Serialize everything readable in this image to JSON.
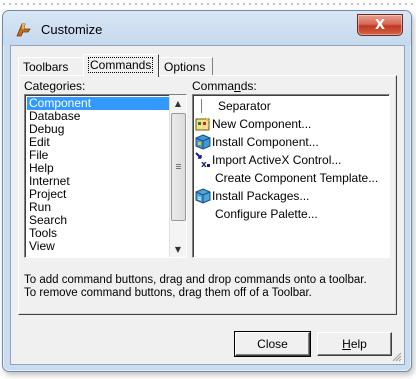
{
  "window": {
    "title": "Customize",
    "close_glyph": "X",
    "app_icon": "delphi-helmet-icon"
  },
  "tabs": [
    {
      "label": "Toolbars",
      "active": false
    },
    {
      "label": "Commands",
      "active": true
    },
    {
      "label": "Options",
      "active": false
    }
  ],
  "categories": {
    "label": "Categories:",
    "items": [
      "Component",
      "Database",
      "Debug",
      "Edit",
      "File",
      "Help",
      "Internet",
      "Project",
      "Run",
      "Search",
      "Tools",
      "View"
    ],
    "selected": "Component"
  },
  "commands": {
    "label": "Commands:",
    "items": [
      {
        "label": "Separator",
        "icon": "separator-icon"
      },
      {
        "label": "New Component...",
        "icon": "new-component-icon"
      },
      {
        "label": "Install Component...",
        "icon": "install-component-icon"
      },
      {
        "label": "Import ActiveX Control...",
        "icon": "import-activex-icon"
      },
      {
        "label": "Create Component Template...",
        "icon": ""
      },
      {
        "label": "Install Packages...",
        "icon": "install-packages-icon"
      },
      {
        "label": "Configure Palette...",
        "icon": ""
      }
    ]
  },
  "help_text": {
    "line1": "To add command buttons, drag and drop commands onto a toolbar.",
    "line2": "To remove command buttons, drag them off of a Toolbar."
  },
  "buttons": {
    "close": "Close",
    "help": "Help"
  },
  "colors": {
    "selection": "#3399ff",
    "title_bar": "#c9dcf0",
    "close_button": "#c0391f"
  }
}
